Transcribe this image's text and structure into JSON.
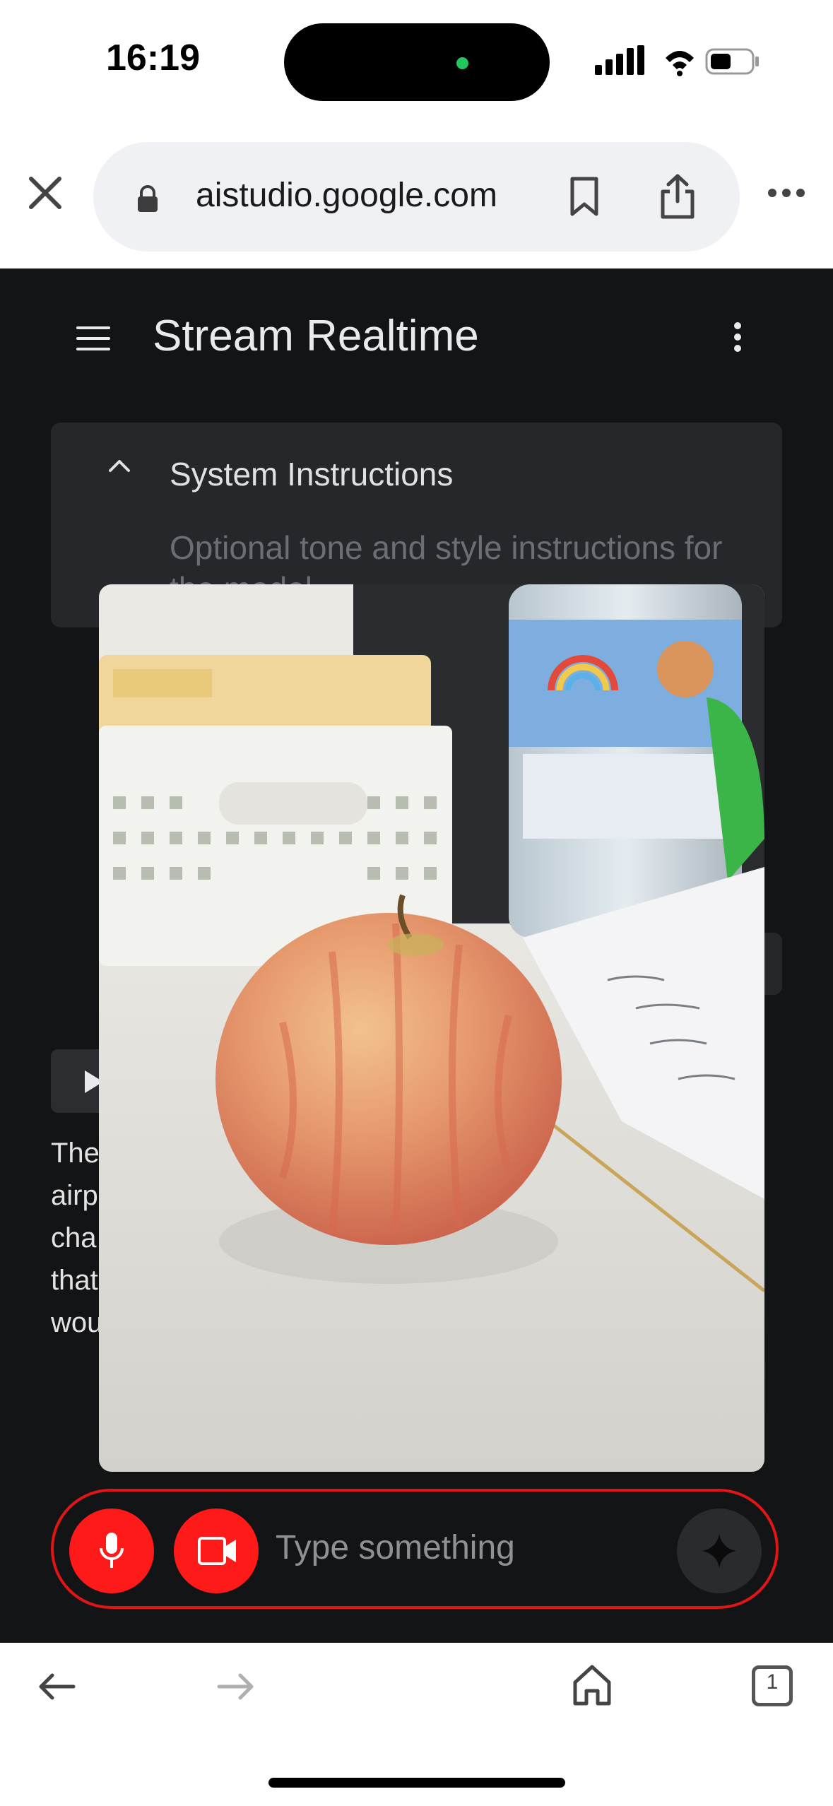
{
  "status_bar": {
    "time": "16:19"
  },
  "browser": {
    "url": "aistudio.google.com",
    "tab_count": "1"
  },
  "app": {
    "title": "Stream Realtime",
    "system_instructions": {
      "title": "System Instructions",
      "placeholder": "Optional tone and style instructions for the model"
    },
    "response_lines": [
      "The",
      "airp",
      "cha",
      "that",
      "wou"
    ]
  },
  "input": {
    "placeholder": "Type something"
  },
  "colors": {
    "accent_red": "#ff1a1a",
    "app_background": "#131416",
    "card_background": "#26272a"
  },
  "icons": {
    "close": "close-icon",
    "lock": "lock-icon",
    "bookmark": "bookmark-icon",
    "share": "share-icon",
    "more": "more-horizontal-icon",
    "menu": "hamburger-icon",
    "kebab": "more-vertical-icon",
    "chevron": "chevron-up-icon",
    "play": "play-icon",
    "mic": "microphone-icon",
    "video": "video-camera-icon",
    "send": "sparkle-icon",
    "back": "arrow-left-icon",
    "forward": "arrow-right-icon",
    "home": "home-icon",
    "tabs": "tabs-icon"
  }
}
